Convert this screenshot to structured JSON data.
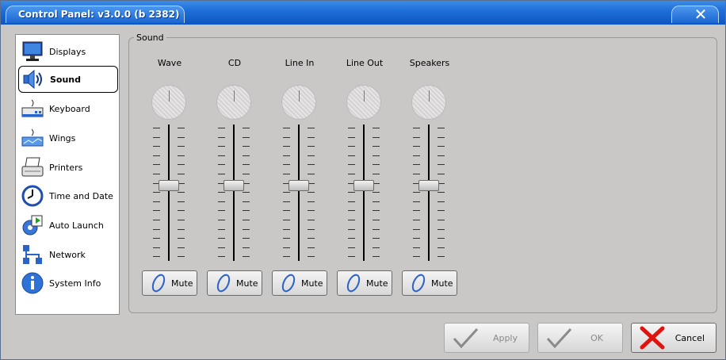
{
  "window": {
    "title": "Control Panel: v3.0.0 (b 2382)",
    "close_glyph": "✕"
  },
  "sidebar": {
    "items": [
      {
        "label": "Displays",
        "icon": "monitor-icon"
      },
      {
        "label": "Sound",
        "icon": "speaker-icon",
        "active": true
      },
      {
        "label": "Keyboard",
        "icon": "keyboard-icon"
      },
      {
        "label": "Wings",
        "icon": "wings-icon"
      },
      {
        "label": "Printers",
        "icon": "printer-icon"
      },
      {
        "label": "Time and Date",
        "icon": "clock-icon"
      },
      {
        "label": "Auto Launch",
        "icon": "auto-launch-icon"
      },
      {
        "label": "Network",
        "icon": "network-icon"
      },
      {
        "label": "System Info",
        "icon": "info-icon"
      }
    ]
  },
  "sound": {
    "group_label": "Sound",
    "channels": [
      {
        "label": "Wave",
        "mute_label": "Mute",
        "level": 0.55
      },
      {
        "label": "CD",
        "mute_label": "Mute",
        "level": 0.55
      },
      {
        "label": "Line In",
        "mute_label": "Mute",
        "level": 0.55
      },
      {
        "label": "Line Out",
        "mute_label": "Mute",
        "level": 0.55
      },
      {
        "label": "Speakers",
        "mute_label": "Mute",
        "level": 0.55
      }
    ]
  },
  "buttons": {
    "apply": {
      "label": "Apply",
      "enabled": false
    },
    "ok": {
      "label": "OK",
      "enabled": false
    },
    "cancel": {
      "label": "Cancel",
      "enabled": true
    }
  },
  "colors": {
    "titlebar": "#1f6fd8",
    "cancel_x": "#e0140f",
    "check": "#8a8a8a",
    "mute_icon": "#2d63c8"
  }
}
